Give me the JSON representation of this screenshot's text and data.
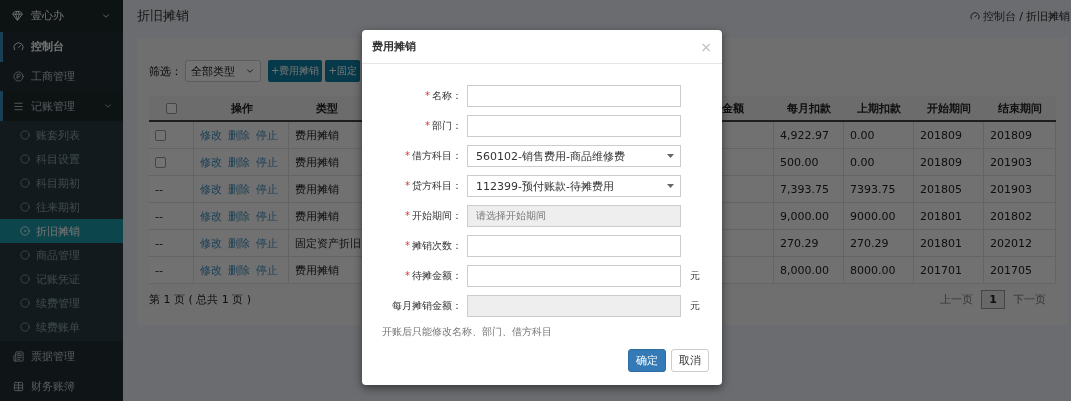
{
  "sidebar": {
    "brand": "壹心办",
    "items": [
      {
        "kind": "dashboard",
        "label": "控制台",
        "selected": true,
        "expanded": false
      },
      {
        "kind": "business",
        "label": "工商管理",
        "selected": false,
        "expanded": false
      },
      {
        "kind": "list",
        "label": "记账管理",
        "selected": false,
        "expanded": true,
        "children": [
          {
            "label": "账套列表",
            "selected": false
          },
          {
            "label": "科目设置",
            "selected": false
          },
          {
            "label": "科目期初",
            "selected": false
          },
          {
            "label": "往来期初",
            "selected": false
          },
          {
            "label": "折旧摊销",
            "selected": true
          },
          {
            "label": "商品管理",
            "selected": false
          },
          {
            "label": "记账凭证",
            "selected": false
          },
          {
            "label": "续费管理",
            "selected": false
          },
          {
            "label": "续费账单",
            "selected": false
          }
        ]
      },
      {
        "kind": "bills",
        "label": "票据管理",
        "selected": false,
        "expanded": false
      },
      {
        "kind": "books",
        "label": "财务账簿",
        "selected": false,
        "expanded": false
      }
    ]
  },
  "header": {
    "title": "折旧摊销",
    "breadcrumb": [
      "控制台",
      "折旧摊销"
    ],
    "separator": "/"
  },
  "filter": {
    "label": "筛选：",
    "value": "全部类型"
  },
  "actions": [
    "+费用摊销",
    "+固定"
  ],
  "table": {
    "select_all": {
      "checked": false
    },
    "columns": [
      "",
      "操作",
      "类型",
      "金额",
      "每月扣款",
      "上期扣款",
      "开始期间",
      "结束期间"
    ],
    "rows": [
      {
        "kind": "checkbox",
        "checked": false,
        "actions": [
          "修改",
          "删除",
          "停止"
        ],
        "type": "费用摊销",
        "monthly": "4,922.97",
        "last": "0.00",
        "start": "201809",
        "end": "201809"
      },
      {
        "kind": "checkbox",
        "checked": false,
        "actions": [
          "修改",
          "删除",
          "停止"
        ],
        "type": "费用摊销",
        "monthly": "500.00",
        "last": "0.00",
        "start": "201809",
        "end": "201903"
      },
      {
        "kind": "dash",
        "mark": "--",
        "actions": [
          "修改",
          "删除",
          "停止"
        ],
        "type": "费用摊销",
        "monthly": "7,393.75",
        "last": "7393.75",
        "start": "201805",
        "end": "201903"
      },
      {
        "kind": "dash",
        "mark": "--",
        "actions": [
          "修改",
          "删除",
          "停止"
        ],
        "type": "费用摊销",
        "monthly": "9,000.00",
        "last": "9000.00",
        "start": "201801",
        "end": "201802"
      },
      {
        "kind": "dash",
        "mark": "--",
        "actions": [
          "修改",
          "删除",
          "停止"
        ],
        "type": "固定资产折旧",
        "monthly": "270.29",
        "last": "270.29",
        "start": "201801",
        "end": "202012"
      },
      {
        "kind": "dash",
        "mark": "--",
        "actions": [
          "修改",
          "删除",
          "停止"
        ],
        "type": "费用摊销",
        "monthly": "8,000.00",
        "last": "8000.00",
        "start": "201701",
        "end": "201705"
      }
    ]
  },
  "pagination": {
    "summary": "第 1 页 ( 总共 1 页 )",
    "prev": "上一页",
    "pages": [
      {
        "label": "1",
        "selected": true
      }
    ],
    "next": "下一页"
  },
  "dialog": {
    "title": "费用摊销",
    "close": "×",
    "required_mark": "*",
    "fields": [
      {
        "kind": "input",
        "label": "名称：",
        "required": true
      },
      {
        "kind": "input",
        "label": "部门：",
        "required": true
      },
      {
        "kind": "select",
        "label": "借方科目：",
        "required": true,
        "value": "560102-销售费用-商品维修费"
      },
      {
        "kind": "select",
        "label": "贷方科目：",
        "required": true,
        "value": "112399-预付账款-待摊费用"
      },
      {
        "kind": "readonly",
        "label": "开始期间：",
        "required": true,
        "placeholder": "请选择开始期间"
      },
      {
        "kind": "input",
        "label": "摊销次数：",
        "required": true
      },
      {
        "kind": "input",
        "label": "待摊金额：",
        "required": true,
        "unit": "元"
      },
      {
        "kind": "readonly",
        "label": "每月摊销金额：",
        "required": false,
        "unit": "元"
      }
    ],
    "hint": "开账后只能修改名称、部门、借方科目",
    "buttons": [
      {
        "label": "确定",
        "primary": true
      },
      {
        "label": "取消",
        "primary": false
      }
    ]
  }
}
